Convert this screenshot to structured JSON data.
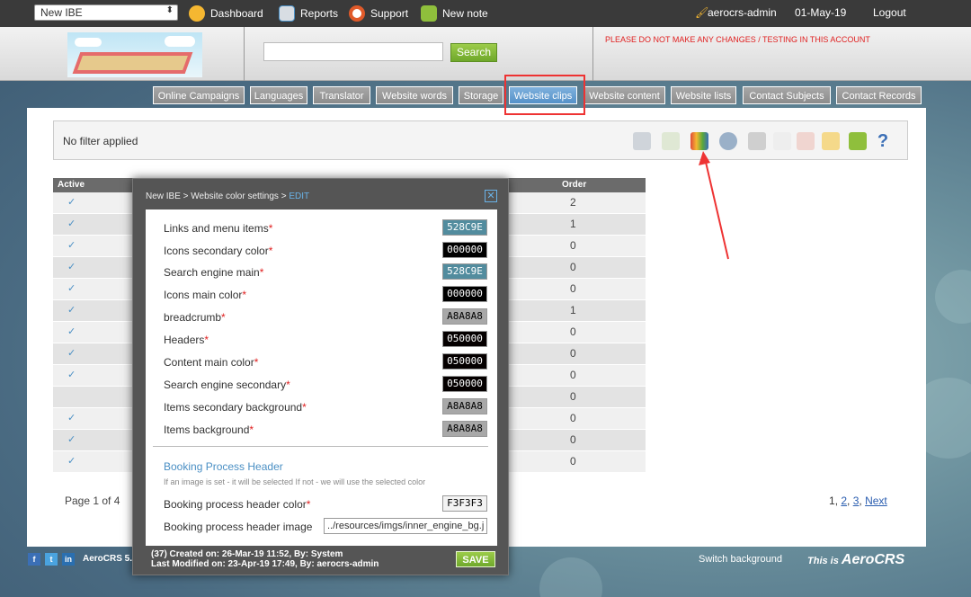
{
  "topbar": {
    "select_value": "New IBE",
    "nav": [
      {
        "label": "Dashboard",
        "icon": "dashboard-icon",
        "color": "#f5b731"
      },
      {
        "label": "Reports",
        "icon": "reports-icon",
        "color": "#4a8fc4"
      },
      {
        "label": "Support",
        "icon": "support-icon",
        "color": "#e05a2a"
      },
      {
        "label": "New note",
        "icon": "note-icon",
        "color": "#8fbf3c"
      }
    ],
    "user": "aerocrs-admin",
    "date": "01-May-19",
    "logout": "Logout"
  },
  "header": {
    "search_button": "Search",
    "warning": "PLEASE DO NOT MAKE ANY CHANGES / TESTING IN THIS ACCOUNT"
  },
  "tabs": [
    "Online Campaigns",
    "Languages",
    "Translator",
    "Website words",
    "Storage",
    "Website clips",
    "Website content",
    "Website lists",
    "Contact Subjects",
    "Contact Records"
  ],
  "active_tab": "Website clips",
  "filter": {
    "text": "No filter applied"
  },
  "table": {
    "headers": {
      "active": "Active",
      "order": "Order"
    },
    "rows": [
      {
        "active": "✓",
        "order": "2"
      },
      {
        "active": "✓",
        "order": "1"
      },
      {
        "active": "✓",
        "order": "0"
      },
      {
        "active": "✓",
        "order": "0"
      },
      {
        "active": "✓",
        "order": "0"
      },
      {
        "active": "✓",
        "order": "1"
      },
      {
        "active": "✓",
        "order": "0"
      },
      {
        "active": "✓",
        "order": "0"
      },
      {
        "active": "✓",
        "order": "0"
      },
      {
        "active": "",
        "order": "0"
      },
      {
        "active": "✓",
        "order": "0"
      },
      {
        "active": "✓",
        "order": "0"
      },
      {
        "active": "✓",
        "order": "0"
      }
    ]
  },
  "pagination": {
    "info": "Page 1 of 4",
    "p1": "1",
    "p2": "2",
    "p3": "3",
    "next": "Next"
  },
  "modal": {
    "breadcrumb": "New IBE > Website color settings > ",
    "edit": "EDIT",
    "fields": [
      {
        "label": "Links and menu items",
        "value": "528C9E",
        "bg": "#528C9E",
        "fg": "#ffffff"
      },
      {
        "label": "Icons secondary color",
        "value": "000000",
        "bg": "#000000",
        "fg": "#ffffff"
      },
      {
        "label": "Search engine main",
        "value": "528C9E",
        "bg": "#528C9E",
        "fg": "#ffffff"
      },
      {
        "label": "Icons main color",
        "value": "000000",
        "bg": "#000000",
        "fg": "#ffffff"
      },
      {
        "label": "breadcrumb",
        "value": "A8A8A8",
        "bg": "#A8A8A8",
        "fg": "#000000"
      },
      {
        "label": "Headers",
        "value": "050000",
        "bg": "#050000",
        "fg": "#ffffff"
      },
      {
        "label": "Content main color",
        "value": "050000",
        "bg": "#050000",
        "fg": "#ffffff"
      },
      {
        "label": "Search engine secondary",
        "value": "050000",
        "bg": "#050000",
        "fg": "#ffffff"
      },
      {
        "label": "Items secondary background",
        "value": "A8A8A8",
        "bg": "#A8A8A8",
        "fg": "#000000"
      },
      {
        "label": "Items background",
        "value": "A8A8A8",
        "bg": "#A8A8A8",
        "fg": "#000000"
      }
    ],
    "section_title": "Booking Process Header",
    "section_hint": "If an image is set - it will be selected If not - we will use the selected color",
    "bp_color_label": "Booking process header color",
    "bp_color_value": "F3F3F3",
    "bp_image_label": "Booking process header image",
    "bp_image_value": "../resources/imgs/inner_engine_bg.j",
    "created": "(37) Created on: 26-Mar-19 11:52, By: System",
    "modified": "Last Modified on: 23-Apr-19 17:49, By: aerocrs-admin",
    "save": "SAVE"
  },
  "footer": {
    "brand": "AeroCRS 5.",
    "switch_bg": "Switch background",
    "this_is": "This is",
    "logo_text": "AeroCRS"
  }
}
